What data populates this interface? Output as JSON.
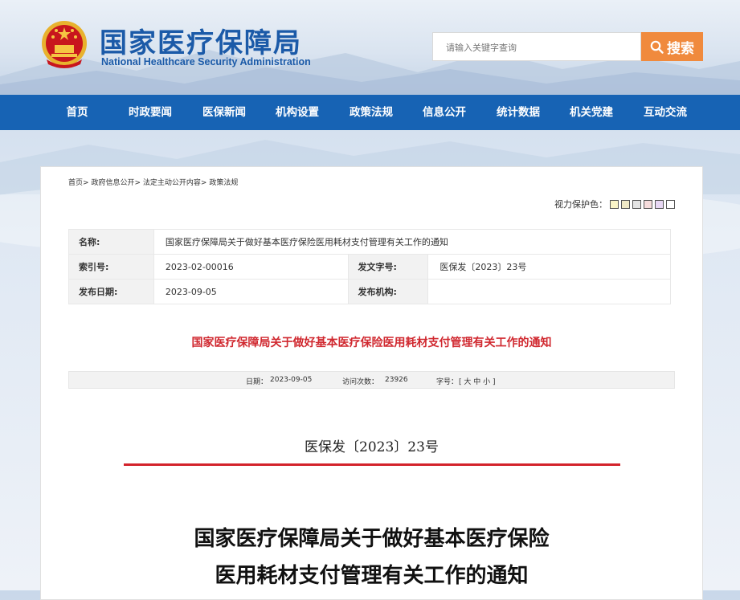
{
  "header": {
    "title": "国家医疗保障局",
    "subtitle": "National Healthcare Security Administration",
    "search": {
      "placeholder": "请输入关键字查询",
      "button_label": "搜索"
    }
  },
  "nav": {
    "items": [
      {
        "label": "首页"
      },
      {
        "label": "时政要闻"
      },
      {
        "label": "医保新闻"
      },
      {
        "label": "机构设置"
      },
      {
        "label": "政策法规"
      },
      {
        "label": "信息公开"
      },
      {
        "label": "统计数据"
      },
      {
        "label": "机关党建"
      },
      {
        "label": "互动交流"
      }
    ]
  },
  "breadcrumb": {
    "items": [
      "首页",
      "政府信息公开",
      "法定主动公开内容",
      "政策法规"
    ],
    "separator": ">"
  },
  "vision": {
    "label": "视力保护色：",
    "swatches": [
      "#faf5c8",
      "#f0e9c6",
      "#e4e4e4",
      "#f6dcdc",
      "#e8d8f4",
      "#ffffff"
    ]
  },
  "info": {
    "name_label": "名称:",
    "name_value": "国家医疗保障局关于做好基本医疗保险医用耗材支付管理有关工作的通知",
    "index_label": "索引号:",
    "index_value": "2023-02-00016",
    "docno_label": "发文字号:",
    "docno_value": "医保发〔2023〕23号",
    "date_label": "发布日期:",
    "date_value": "2023-09-05",
    "org_label": "发布机构:",
    "org_value": ""
  },
  "article": {
    "title": "国家医疗保障局关于做好基本医疗保险医用耗材支付管理有关工作的通知",
    "meta": {
      "date_label": "日期：",
      "date_value": "2023-09-05",
      "visits_label": "访问次数：",
      "visits_value": "23926",
      "font_label": "字号：",
      "font_value": "[ 大 中 小 ]"
    },
    "doc_number": "医保发〔2023〕23号",
    "doc_title_line1": "国家医疗保障局关于做好基本医疗保险",
    "doc_title_line2": "医用耗材支付管理有关工作的通知"
  }
}
